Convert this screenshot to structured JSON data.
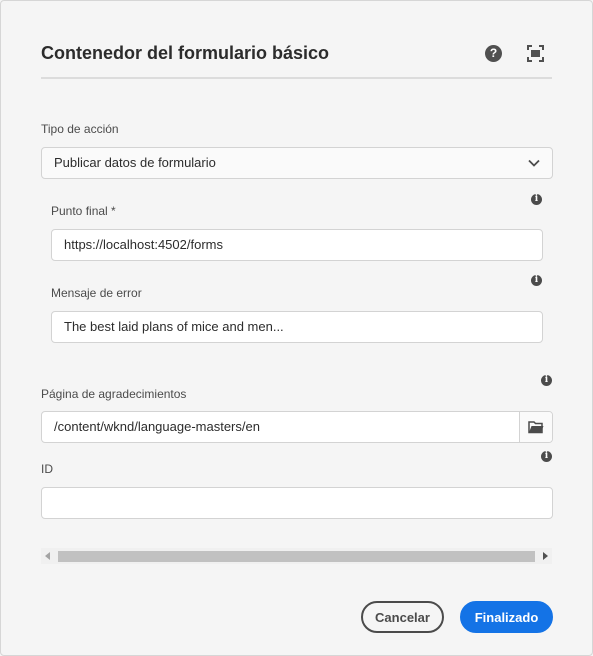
{
  "dialog": {
    "title": "Contenedor del formulario básico",
    "help_glyph": "?"
  },
  "action_type": {
    "label": "Tipo de acción",
    "value": "Publicar datos de formulario"
  },
  "endpoint": {
    "label": "Punto final *",
    "value": "https://localhost:4502/forms"
  },
  "error_message": {
    "label": "Mensaje de error",
    "value": "The best laid plans of mice and men..."
  },
  "thank_you_page": {
    "label": "Página de agradecimientos",
    "value": "/content/wknd/language-masters/en"
  },
  "id_field": {
    "label": "ID",
    "value": ""
  },
  "info_glyph": "i",
  "footer": {
    "cancel_label": "Cancelar",
    "done_label": "Finalizado"
  },
  "colors": {
    "primary": "#1473e6",
    "background": "#f5f5f5"
  }
}
